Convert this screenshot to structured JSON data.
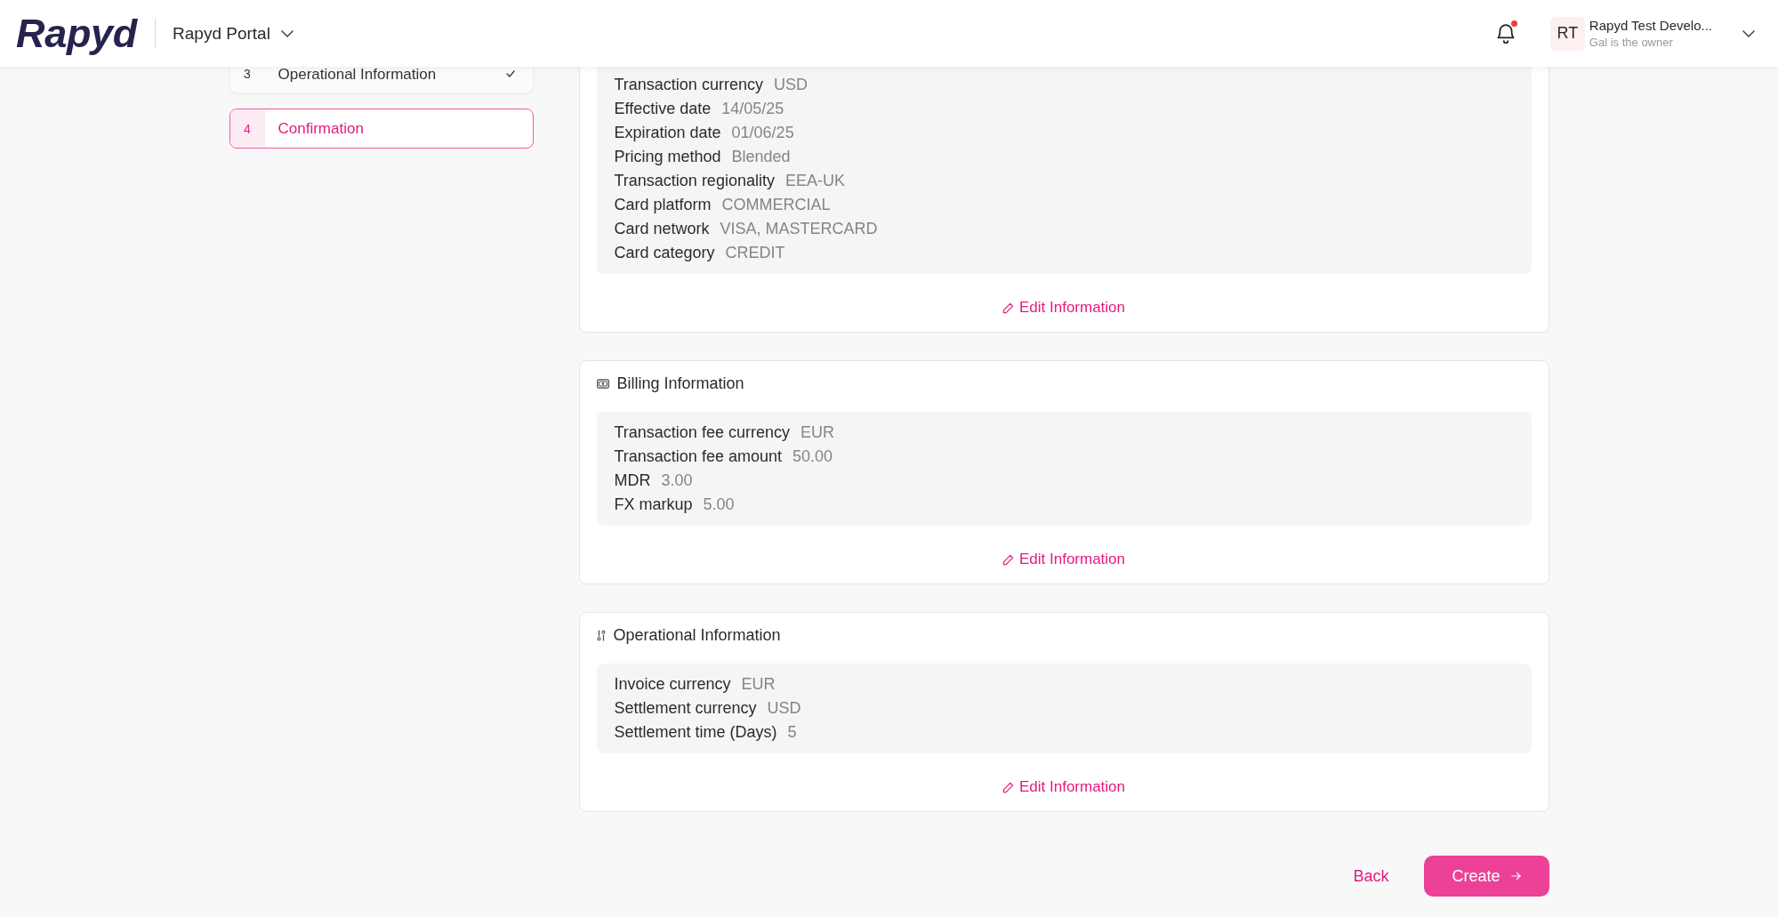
{
  "header": {
    "logo": "Rapyd",
    "portal": "Rapyd Portal",
    "notifications": {
      "unread": true
    },
    "account": {
      "initials": "RT",
      "name": "Rapyd Test Develo...",
      "role": "Gal is the owner"
    }
  },
  "steps": [
    {
      "number": "3",
      "label": "Operational Information",
      "done": true,
      "selected": false
    },
    {
      "number": "4",
      "label": "Confirmation",
      "done": false,
      "selected": true
    }
  ],
  "sections": [
    {
      "rows": [
        {
          "label": "Transaction currency",
          "value": "USD"
        },
        {
          "label": "Effective date",
          "value": "14/05/25"
        },
        {
          "label": "Expiration date",
          "value": "01/06/25"
        },
        {
          "label": "Pricing method",
          "value": "Blended"
        },
        {
          "label": "Transaction regionality",
          "value": "EEA-UK"
        },
        {
          "label": "Card platform",
          "value": "COMMERCIAL"
        },
        {
          "label": "Card network",
          "value": "VISA, MASTERCARD"
        },
        {
          "label": "Card category",
          "value": "CREDIT"
        }
      ],
      "edit_link": "Edit Information"
    },
    {
      "kind": "billing",
      "title": "Billing Information",
      "rows": [
        {
          "label": "Transaction fee currency",
          "value": "EUR"
        },
        {
          "label": "Transaction fee amount",
          "value": "50.00"
        },
        {
          "label": "MDR",
          "value": "3.00"
        },
        {
          "label": "FX markup",
          "value": "5.00"
        }
      ],
      "edit_link": "Edit Information"
    },
    {
      "kind": "operational",
      "title": "Operational Information",
      "rows": [
        {
          "label": "Invoice currency",
          "value": "EUR"
        },
        {
          "label": "Settlement currency",
          "value": "USD"
        },
        {
          "label": "Settlement time (Days)",
          "value": "5"
        }
      ],
      "edit_link": "Edit Information"
    }
  ],
  "actions": {
    "back": "Back",
    "create": "Create"
  }
}
